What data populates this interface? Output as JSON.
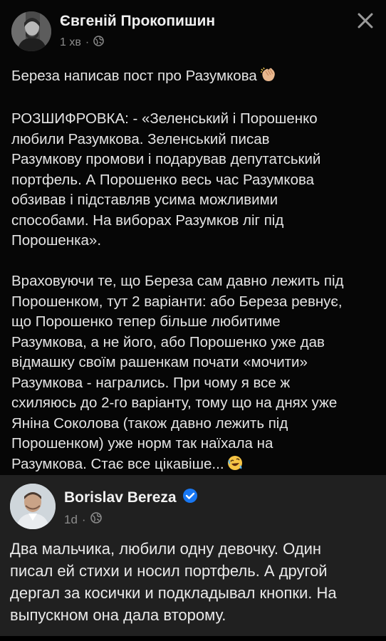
{
  "post": {
    "author": "Євгеній Прокопишин",
    "time": "1 хв",
    "separator": "·",
    "privacy_icon": "globe-icon",
    "close_icon": "close-icon",
    "lines": [
      "Береза написав пост про Разумкова",
      "",
      "РОЗШИФРОВКА: - «Зеленський і Порошенко",
      "любили Разумкова. Зеленський писав",
      "Разумкову промови і подарував депутатський",
      "портфель. А Порошенко весь час Разумкова",
      "обзивав і підставляв усима можливими",
      "способами. На виборах Разумков ліг під",
      "Порошенка».",
      "",
      "Враховуючи те, що Береза сам давно лежить під",
      "Порошенком, тут 2 варіанти: або Береза ревнує,",
      "що Порошенко тепер більше любитиме",
      "Разумкова, а не його, або Порошенко уже дав",
      "відмашку своїм рашенкам почати «мочити»",
      "Разумкова - награлись. При чому я все ж",
      "схиляюсь до 2-го варіанту, тому що на днях уже",
      "Яніна Соколова (також давно лежить під",
      "Порошенком) уже норм так наїхала на",
      "Разумкова. Стає все цікавіше..."
    ],
    "emoji_clap": "clapping-hands-emoji",
    "emoji_laugh": "rolling-on-floor-laughing-emoji"
  },
  "screenshot": {
    "author": "Borislav Bereza",
    "verified_icon": "verified-badge-icon",
    "time": "1d",
    "separator": "·",
    "privacy_icon": "globe-icon",
    "lines": [
      "Два мальчика, любили одну девочку. Один",
      "писал ей стихи и носил портфель. А другой",
      "дергал за косички и подкладывал кнопки. На",
      "выпускном она дала второму."
    ]
  },
  "colors": {
    "background": "#060606",
    "screenshot_background": "#202020",
    "meta_text": "#8c8c8c",
    "verified_blue": "#1877f2"
  }
}
